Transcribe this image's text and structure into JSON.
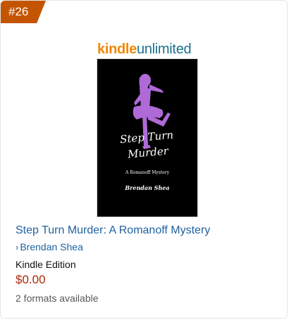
{
  "rank": "#26",
  "badge_color": "#c45500",
  "logo": {
    "kindle": "kindle",
    "unlimited": "unlimited"
  },
  "cover": {
    "title": "Step Turn\nMurder",
    "subtitle": "A Romanoff Mystery",
    "author": "Brendan Shea",
    "silhouette_color": "#b06ad8"
  },
  "book": {
    "title": "Step Turn Murder: A Romanoff Mystery",
    "author_chevron": "›",
    "author": "Brendan Shea",
    "edition": "Kindle Edition",
    "price": "$0.00",
    "formats": "2 formats available"
  },
  "colors": {
    "link": "#2162a1",
    "price": "#b12704",
    "kindle_orange": "#f08804",
    "unlimited_blue": "#1e6f8f"
  }
}
